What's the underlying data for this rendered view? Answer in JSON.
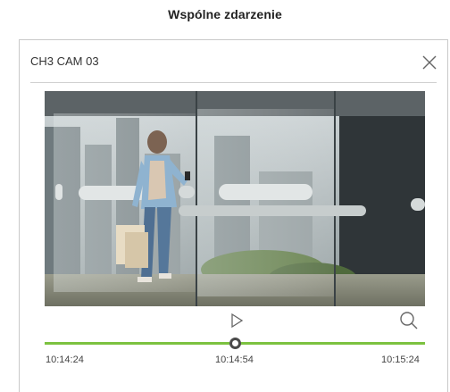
{
  "heading": "Wspólne zdarzenie",
  "dialog": {
    "title": "CH3 CAM 03"
  },
  "icons": {
    "close": "close-icon",
    "play": "play-icon",
    "zoom": "search-icon"
  },
  "playback": {
    "start_time": "10:14:24",
    "current_time": "10:14:54",
    "end_time": "10:15:24",
    "progress": 0.5
  },
  "colors": {
    "timeline": "#7cc240",
    "thumb_border": "#4a4a4a"
  }
}
